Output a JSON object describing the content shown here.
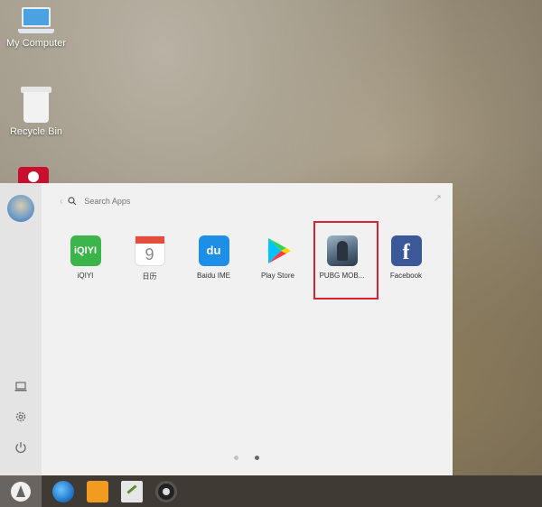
{
  "desktop": {
    "icons": [
      {
        "label": "My Computer",
        "icon": "laptop-icon"
      },
      {
        "label": "Recycle Bin",
        "icon": "recycle-bin-icon"
      }
    ]
  },
  "launcher": {
    "search": {
      "placeholder": "Search Apps"
    },
    "apps": [
      {
        "label": "iQIYI",
        "icon": "iqiyi-icon",
        "glyph": "iQIYI"
      },
      {
        "label": "日历",
        "icon": "calendar-icon",
        "glyph": "9"
      },
      {
        "label": "Baidu IME",
        "icon": "baidu-ime-icon",
        "glyph": "du"
      },
      {
        "label": "Play Store",
        "icon": "play-store-icon"
      },
      {
        "label": "PUBG MOB...",
        "icon": "pubg-mobile-icon"
      },
      {
        "label": "Facebook",
        "icon": "facebook-icon",
        "glyph": "f"
      }
    ],
    "highlighted_app": "PUBG MOB...",
    "page_count": 2,
    "active_page": 2
  },
  "colors": {
    "highlight_border": "#d9232e",
    "panel_bg": "#f1f1f1",
    "taskbar_bg": "#3f3a33"
  }
}
